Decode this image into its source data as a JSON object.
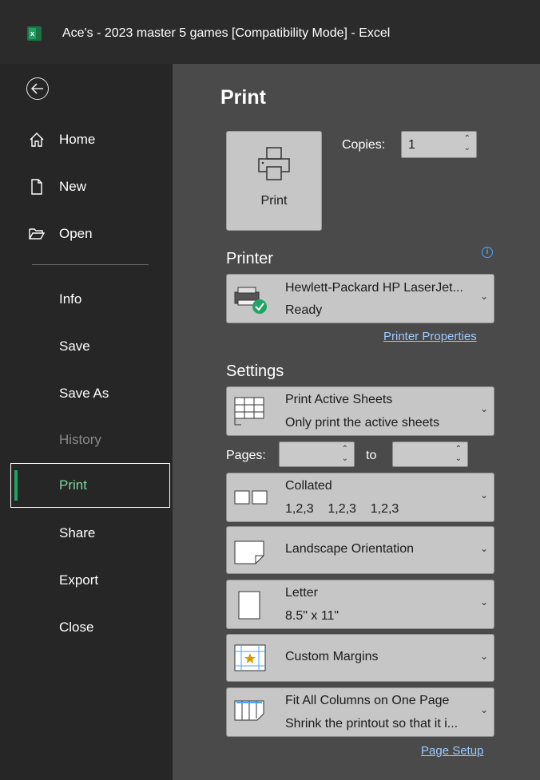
{
  "window": {
    "app_icon": "excel-icon",
    "app_icon_letter": "x",
    "title": "Ace's - 2023 master 5 games  [Compatibility Mode]  -  Excel"
  },
  "sidebar": {
    "back_icon": "back-arrow-icon",
    "items": [
      {
        "label": "Home",
        "icon": "home-icon"
      },
      {
        "label": "New",
        "icon": "new-document-icon"
      },
      {
        "label": "Open",
        "icon": "open-folder-icon"
      },
      {
        "label": "Info"
      },
      {
        "label": "Save"
      },
      {
        "label": "Save As"
      },
      {
        "label": "History",
        "disabled": true
      },
      {
        "label": "Print",
        "selected": true
      },
      {
        "label": "Share"
      },
      {
        "label": "Export"
      },
      {
        "label": "Close"
      }
    ]
  },
  "print": {
    "title": "Print",
    "button_label": "Print",
    "copies_label": "Copies:",
    "copies_value": "1"
  },
  "printer": {
    "section_label": "Printer",
    "name": "Hewlett-Packard HP LaserJet...",
    "status": "Ready",
    "properties_link": "Printer Properties"
  },
  "settings": {
    "section_label": "Settings",
    "what": {
      "line1": "Print Active Sheets",
      "line2": "Only print the active sheets"
    },
    "pages_label": "Pages:",
    "pages_from": "",
    "to_label": "to",
    "pages_to": "",
    "collation": {
      "line1": "Collated",
      "line2": "1,2,3    1,2,3    1,2,3"
    },
    "orientation": {
      "line1": "Landscape Orientation"
    },
    "paper": {
      "line1": "Letter",
      "line2": "8.5\" x 11\""
    },
    "margins": {
      "line1": "Custom Margins"
    },
    "scaling": {
      "line1": "Fit All Columns on One Page",
      "line2": "Shrink the printout so that it i..."
    },
    "page_setup_link": "Page Setup"
  },
  "colors": {
    "accent": "#21a366",
    "link": "#9cc9ff",
    "info": "#4aa3ff"
  }
}
